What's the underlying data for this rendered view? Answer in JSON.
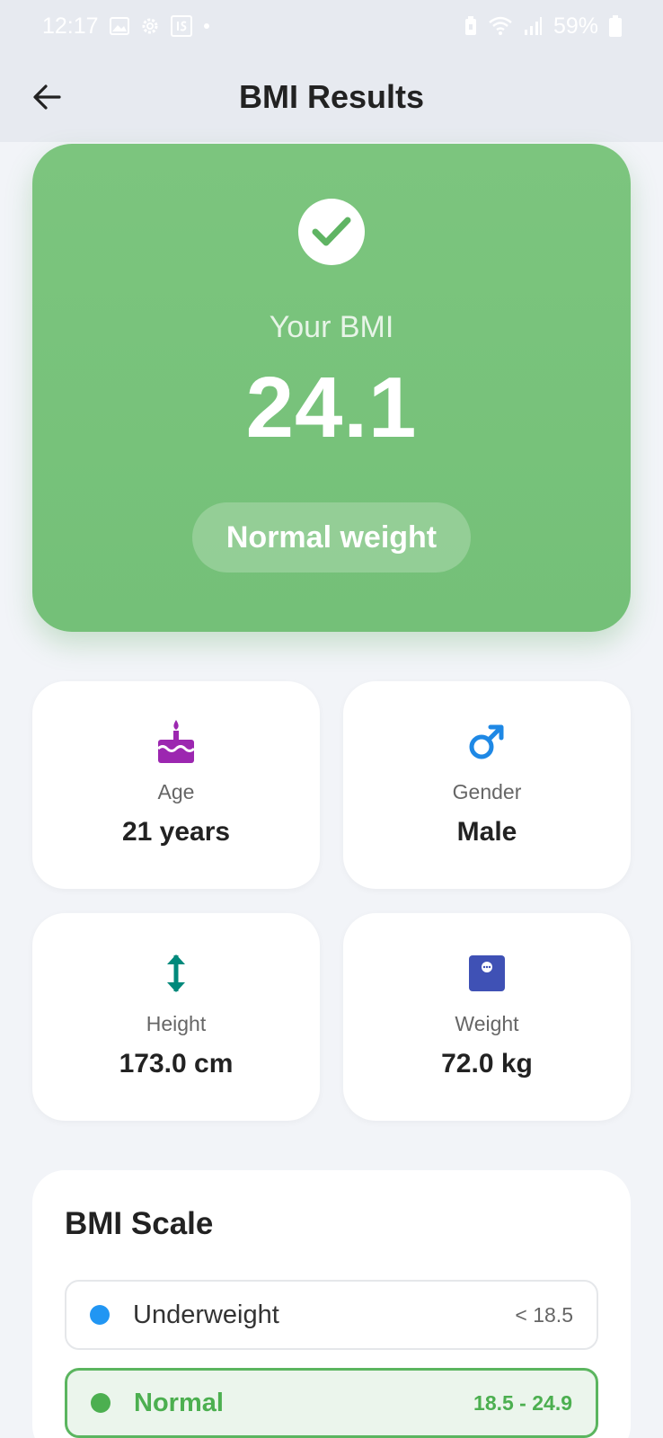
{
  "status_bar": {
    "time": "12:17",
    "battery": "59%"
  },
  "header": {
    "title": "BMI Results"
  },
  "result": {
    "label": "Your BMI",
    "value": "24.1",
    "category": "Normal weight"
  },
  "info_cards": [
    {
      "label": "Age",
      "value": "21 years",
      "icon": "cake-icon",
      "color": "#9c27b0"
    },
    {
      "label": "Gender",
      "value": "Male",
      "icon": "male-icon",
      "color": "#1e88e5"
    },
    {
      "label": "Height",
      "value": "173.0 cm",
      "icon": "height-arrows-icon",
      "color": "#00897b"
    },
    {
      "label": "Weight",
      "value": "72.0 kg",
      "icon": "scale-icon",
      "color": "#3f51b5"
    }
  ],
  "bmi_scale": {
    "title": "BMI Scale",
    "items": [
      {
        "name": "Underweight",
        "range": "< 18.5",
        "color": "#2196f3",
        "active": false
      },
      {
        "name": "Normal",
        "range": "18.5 - 24.9",
        "color": "#4caf50",
        "active": true
      }
    ]
  },
  "colors": {
    "accent_green": "#7cc57e",
    "background": "#f2f4f8"
  }
}
